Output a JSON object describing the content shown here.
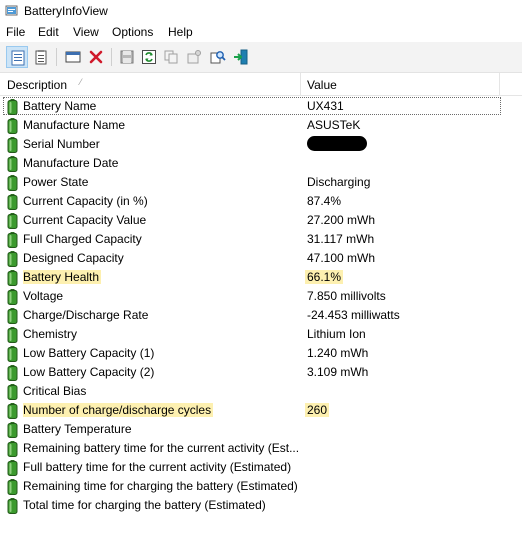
{
  "window": {
    "title": "BatteryInfoView"
  },
  "menu": [
    "File",
    "Edit",
    "View",
    "Options",
    "Help"
  ],
  "toolbar": {
    "buttons": [
      "html-report-icon",
      "properties-list-icon",
      "options-icon",
      "delete-icon",
      "save-icon",
      "refresh-icon",
      "copy-icon",
      "properties-icon",
      "find-icon",
      "exit-icon"
    ]
  },
  "columns": {
    "description": "Description",
    "value": "Value"
  },
  "rows": [
    {
      "label": "Battery Name",
      "value": "UX431"
    },
    {
      "label": "Manufacture Name",
      "value": "ASUSTeK"
    },
    {
      "label": "Serial Number",
      "value": ""
    },
    {
      "label": "Manufacture Date",
      "value": ""
    },
    {
      "label": "Power State",
      "value": "Discharging"
    },
    {
      "label": "Current Capacity (in %)",
      "value": "87.4%"
    },
    {
      "label": "Current Capacity Value",
      "value": "27.200 mWh"
    },
    {
      "label": "Full Charged Capacity",
      "value": "31.117 mWh"
    },
    {
      "label": "Designed Capacity",
      "value": "47.100 mWh"
    },
    {
      "label": "Battery Health",
      "value": "66.1%"
    },
    {
      "label": "Voltage",
      "value": "7.850 millivolts"
    },
    {
      "label": "Charge/Discharge Rate",
      "value": "-24.453 milliwatts"
    },
    {
      "label": "Chemistry",
      "value": "Lithium Ion"
    },
    {
      "label": "Low Battery Capacity (1)",
      "value": "1.240 mWh"
    },
    {
      "label": "Low Battery Capacity (2)",
      "value": "3.109 mWh"
    },
    {
      "label": "Critical Bias",
      "value": ""
    },
    {
      "label": "Number of charge/discharge cycles",
      "value": "260"
    },
    {
      "label": "Battery Temperature",
      "value": ""
    },
    {
      "label": "Remaining battery time for the current activity (Est...",
      "value": ""
    },
    {
      "label": "Full battery time for the current activity (Estimated)",
      "value": ""
    },
    {
      "label": "Remaining time for charging the battery (Estimated)",
      "value": ""
    },
    {
      "label": "Total  time for charging the battery (Estimated)",
      "value": ""
    }
  ],
  "colors": {
    "highlight": "#fdf0b0",
    "battery_green": "#3c9a2e",
    "selection_border": "#6b6b6b"
  }
}
